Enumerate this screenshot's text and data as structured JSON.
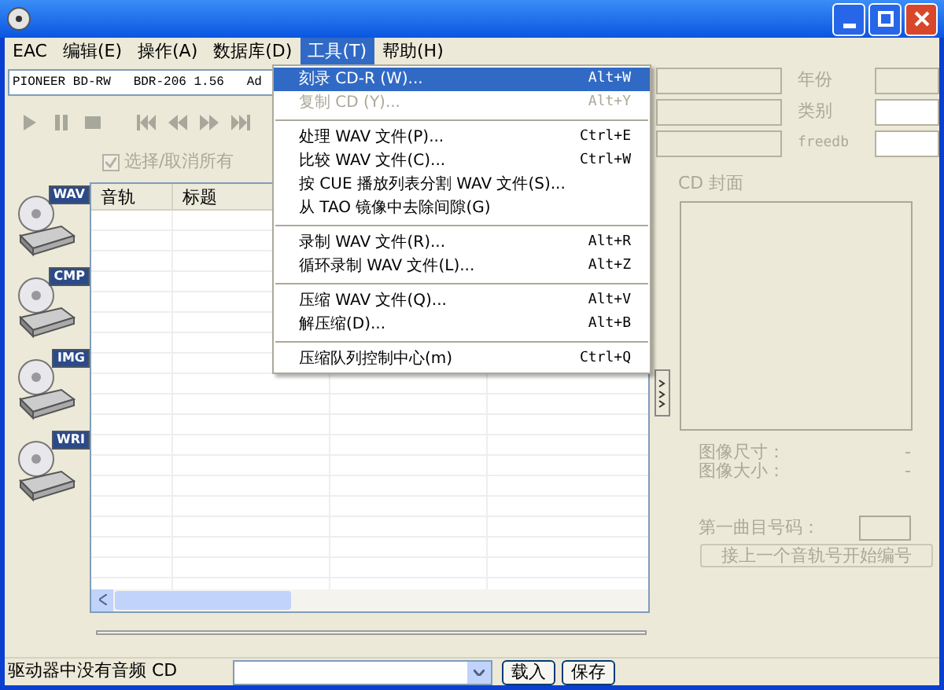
{
  "menu_bar": [
    {
      "label": "EAC",
      "selected": false
    },
    {
      "label": "编辑(E)",
      "selected": false
    },
    {
      "label": "操作(A)",
      "selected": false
    },
    {
      "label": "数据库(D)",
      "selected": false
    },
    {
      "label": "工具(T)",
      "selected": true
    },
    {
      "label": "帮助(H)",
      "selected": false
    }
  ],
  "drive_select": {
    "value": "PIONEER BD-RW   BDR-206 1.56   Ad"
  },
  "select_all": {
    "label": "选择/取消所有",
    "checked": true,
    "disabled": true
  },
  "side_buttons": [
    {
      "label": "WAV"
    },
    {
      "label": "CMP"
    },
    {
      "label": "IMG"
    },
    {
      "label": "WRI"
    }
  ],
  "track_table": {
    "columns": [
      "音轨",
      "标题"
    ]
  },
  "tools_menu": [
    {
      "kind": "item",
      "label": "刻录 CD-R (W)...",
      "shortcut": "Alt+W",
      "selected": true,
      "disabled": false
    },
    {
      "kind": "item",
      "label": "复制 CD (Y)...",
      "shortcut": "Alt+Y",
      "selected": false,
      "disabled": true
    },
    {
      "kind": "separator"
    },
    {
      "kind": "item",
      "label": "处理 WAV 文件(P)...",
      "shortcut": "Ctrl+E",
      "selected": false,
      "disabled": false
    },
    {
      "kind": "item",
      "label": "比较 WAV 文件(C)...",
      "shortcut": "Ctrl+W",
      "selected": false,
      "disabled": false
    },
    {
      "kind": "item",
      "label": "按 CUE 播放列表分割 WAV 文件(S)...",
      "selected": false,
      "disabled": false
    },
    {
      "kind": "item",
      "label": "从 TAO 镜像中去除间隙(G)",
      "selected": false,
      "disabled": false
    },
    {
      "kind": "separator"
    },
    {
      "kind": "item",
      "label": "录制 WAV 文件(R)...",
      "shortcut": "Alt+R",
      "selected": false,
      "disabled": false
    },
    {
      "kind": "item",
      "label": "循环录制 WAV 文件(L)...",
      "shortcut": "Alt+Z",
      "selected": false,
      "disabled": false
    },
    {
      "kind": "separator"
    },
    {
      "kind": "item",
      "label": "压缩 WAV 文件(Q)...",
      "shortcut": "Alt+V",
      "selected": false,
      "disabled": false
    },
    {
      "kind": "item",
      "label": "解压缩(D)...",
      "shortcut": "Alt+B",
      "selected": false,
      "disabled": false
    },
    {
      "kind": "separator"
    },
    {
      "kind": "item",
      "label": "压缩队列控制中心(m)",
      "shortcut": "Ctrl+Q",
      "selected": false,
      "disabled": false
    }
  ],
  "album_info": [
    {
      "label": "年份"
    },
    {
      "label": "类别"
    },
    {
      "label": "freedb"
    }
  ],
  "cover": {
    "title": "CD 封面"
  },
  "image_info": [
    {
      "label": "图像尺寸：",
      "value": "-"
    },
    {
      "label": "图像大小：",
      "value": "-"
    }
  ],
  "first_track": {
    "label": "第一曲目号码："
  },
  "renumber_button": {
    "label": "接上一个音轨号开始编号"
  },
  "status_bar": {
    "text": "驱动器中没有音频 CD",
    "buttons": [
      "载入",
      "保存"
    ]
  }
}
